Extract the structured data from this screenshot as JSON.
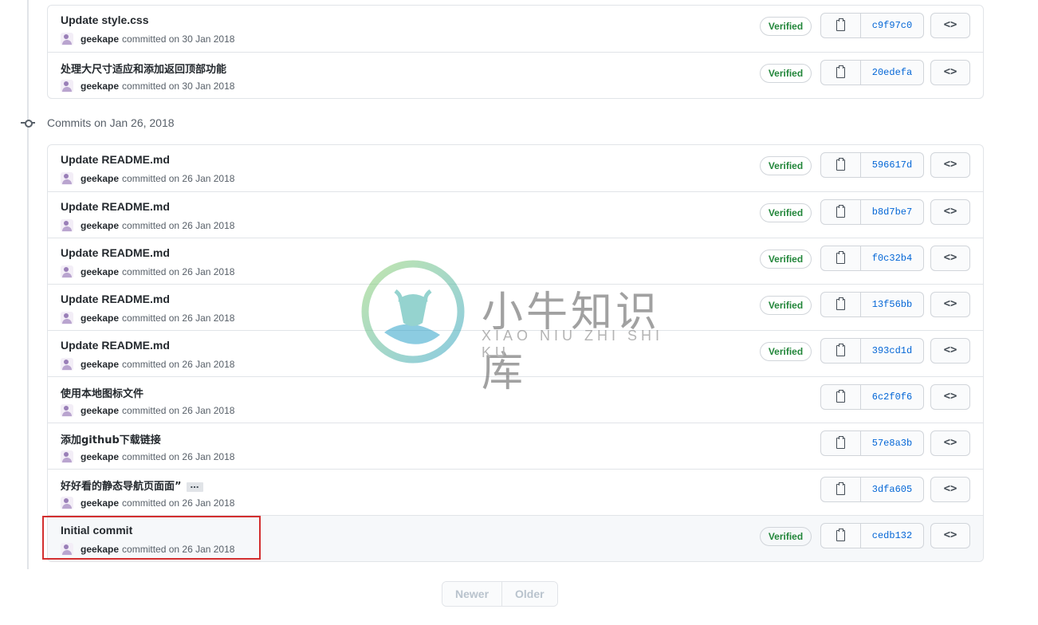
{
  "groups": [
    {
      "commits": [
        {
          "message": "Update style.css",
          "author": "geekape",
          "committed": "committed on 30 Jan 2018",
          "verified": "Verified",
          "sha": "c9f97c0"
        },
        {
          "message": "处理大尺寸适应和添加返回顶部功能",
          "author": "geekape",
          "committed": "committed on 30 Jan 2018",
          "verified": "Verified",
          "sha": "20edefa"
        }
      ]
    },
    {
      "date_label": "Commits on Jan 26, 2018",
      "commits": [
        {
          "message": "Update README.md",
          "author": "geekape",
          "committed": "committed on 26 Jan 2018",
          "verified": "Verified",
          "sha": "596617d"
        },
        {
          "message": "Update README.md",
          "author": "geekape",
          "committed": "committed on 26 Jan 2018",
          "verified": "Verified",
          "sha": "b8d7be7"
        },
        {
          "message": "Update README.md",
          "author": "geekape",
          "committed": "committed on 26 Jan 2018",
          "verified": "Verified",
          "sha": "f0c32b4"
        },
        {
          "message": "Update README.md",
          "author": "geekape",
          "committed": "committed on 26 Jan 2018",
          "verified": "Verified",
          "sha": "13f56bb"
        },
        {
          "message": "Update README.md",
          "author": "geekape",
          "committed": "committed on 26 Jan 2018",
          "verified": "Verified",
          "sha": "393cd1d"
        },
        {
          "message": "使用本地图标文件",
          "author": "geekape",
          "committed": "committed on 26 Jan 2018",
          "verified": "",
          "sha": "6c2f0f6"
        },
        {
          "message": "添加github下载链接",
          "author": "geekape",
          "committed": "committed on 26 Jan 2018",
          "verified": "",
          "sha": "57e8a3b"
        },
        {
          "message": "好好看的静态导航页面面”",
          "author": "geekape",
          "committed": "committed on 26 Jan 2018",
          "verified": "",
          "sha": "3dfa605",
          "ellipsis": "…"
        },
        {
          "message": "Initial commit",
          "author": "geekape",
          "committed": "committed on 26 Jan 2018",
          "verified": "Verified",
          "sha": "cedb132",
          "highlighted": true
        }
      ]
    }
  ],
  "browse_code_label": "<>",
  "pagination": {
    "newer": "Newer",
    "older": "Older"
  },
  "watermark": {
    "title": "小牛知识库",
    "subtitle": "XIAO NIU ZHI SHI KU"
  },
  "colors": {
    "verified": "#22863a",
    "sha_link": "#0366d6",
    "highlight_box": "#d32f2f",
    "border": "#e1e4e8"
  }
}
